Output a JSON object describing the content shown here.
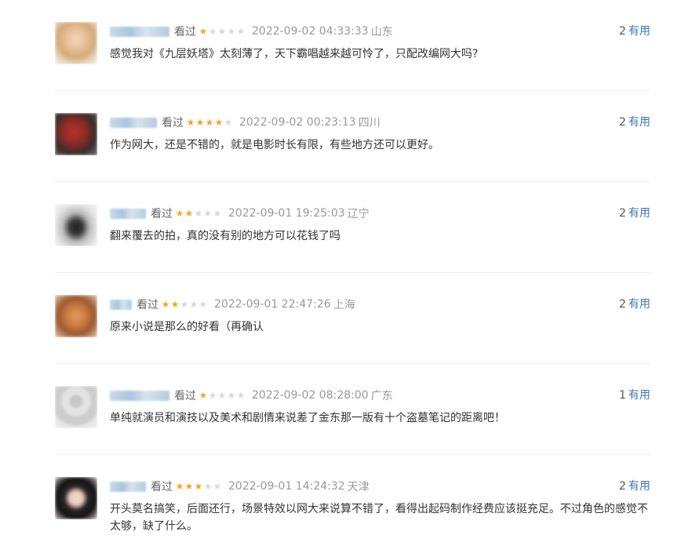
{
  "reviews": [
    {
      "watched_label": "看过",
      "rating": 1,
      "date": "2022-09-02 04:33:33",
      "location": "山东",
      "useful_count": "2",
      "useful_label": "有用",
      "content": "感觉我对《九层妖塔》太刻薄了，天下霸唱越来越可怜了，只配改编网大吗?"
    },
    {
      "watched_label": "看过",
      "rating": 4,
      "date": "2022-09-02 00:23:13",
      "location": "四川",
      "useful_count": "2",
      "useful_label": "有用",
      "content": "作为网大，还是不错的，就是电影时长有限，有些地方还可以更好。"
    },
    {
      "watched_label": "看过",
      "rating": 2,
      "date": "2022-09-01 19:25:03",
      "location": "辽宁",
      "useful_count": "2",
      "useful_label": "有用",
      "content": "翻来覆去的拍，真的没有别的地方可以花钱了吗"
    },
    {
      "watched_label": "看过",
      "rating": 2,
      "date": "2022-09-01 22:47:26",
      "location": "上海",
      "useful_count": "2",
      "useful_label": "有用",
      "content": "原来小说是那么的好看（再确认"
    },
    {
      "watched_label": "看过",
      "rating": 1,
      "date": "2022-09-02 08:28:00",
      "location": "广东",
      "useful_count": "1",
      "useful_label": "有用",
      "content": "单纯就演员和演技以及美术和剧情来说差了金东那一版有十个盗墓笔记的距离吧！"
    },
    {
      "watched_label": "看过",
      "rating": 3,
      "date": "2022-09-01 14:24:32",
      "location": "天津",
      "useful_count": "2",
      "useful_label": "有用",
      "content": "开头莫名搞笑，后面还行，场景特效以网大来说算不错了，看得出起码制作经费应该挺充足。不过角色的感觉不太够，缺了什么。"
    }
  ],
  "colors": {
    "star_on": "#f5a623",
    "star_off": "#d9d9d9",
    "link": "#3d77a8",
    "meta": "#999999"
  }
}
